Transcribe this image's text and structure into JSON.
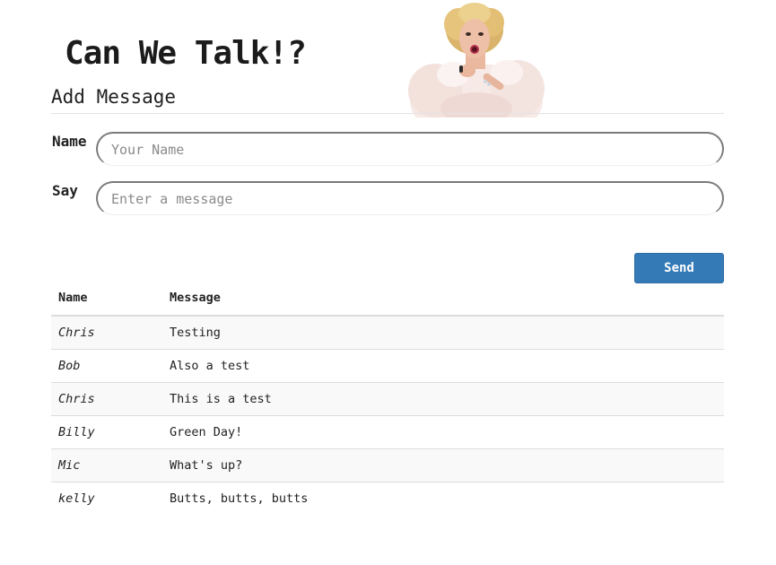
{
  "app": {
    "title": "Can We Talk!?"
  },
  "form": {
    "heading": "Add Message",
    "name_label": "Name",
    "name_placeholder": "Your Name",
    "name_value": "",
    "say_label": "Say",
    "say_placeholder": "Enter a message",
    "say_value": "",
    "send_label": "Send"
  },
  "table": {
    "headers": {
      "name": "Name",
      "message": "Message"
    },
    "rows": [
      {
        "name": "Chris",
        "message": "Testing"
      },
      {
        "name": "Bob",
        "message": "Also a test"
      },
      {
        "name": "Chris",
        "message": "This is a test"
      },
      {
        "name": "Billy",
        "message": "Green Day!"
      },
      {
        "name": "Mic",
        "message": "What's up?"
      },
      {
        "name": "kelly",
        "message": "Butts, butts, butts"
      }
    ]
  },
  "colors": {
    "accent": "#337ab7",
    "stripe": "#f9f9f9",
    "rule": "#dddddd"
  }
}
